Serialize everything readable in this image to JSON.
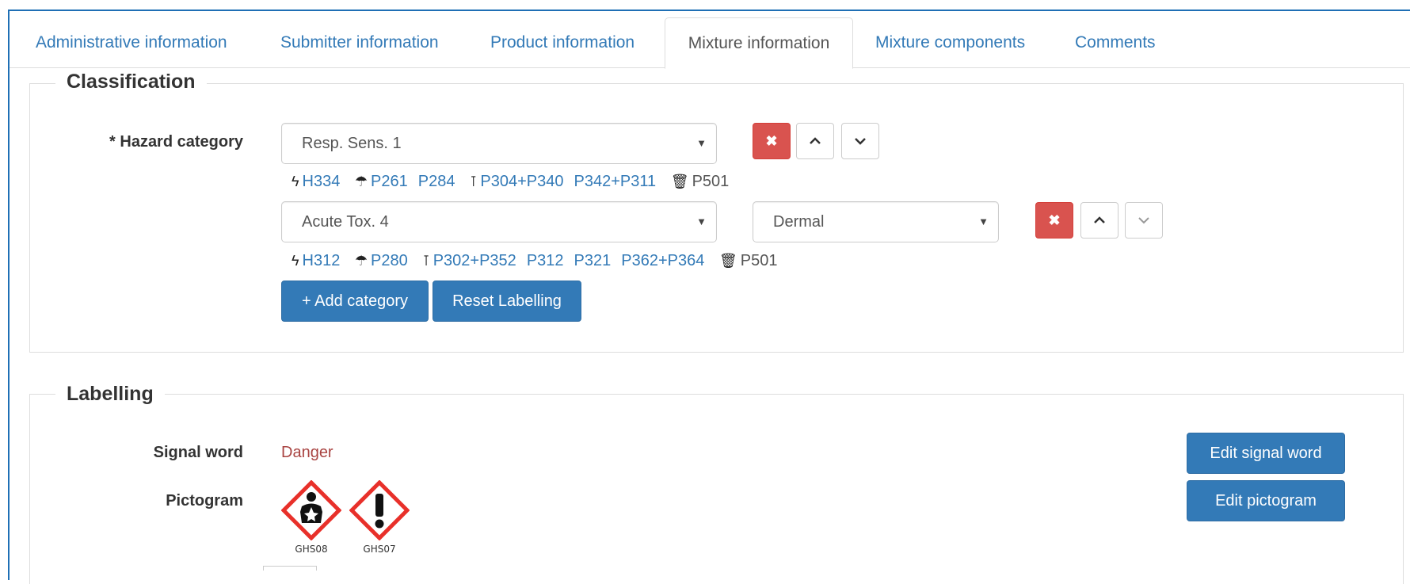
{
  "tabs": [
    {
      "label": "Administrative information",
      "active": false
    },
    {
      "label": "Submitter information",
      "active": false
    },
    {
      "label": "Product information",
      "active": false
    },
    {
      "label": "Mixture information",
      "active": true
    },
    {
      "label": "Mixture components",
      "active": false
    },
    {
      "label": "Comments",
      "active": false
    }
  ],
  "classification": {
    "legend": "Classification",
    "hazard_label": "* Hazard category",
    "rows": [
      {
        "category": "Resp. Sens. 1",
        "route": "",
        "hazard_codes": [
          "H334"
        ],
        "prevention_codes": [
          "P261",
          "P284"
        ],
        "response_codes": [
          "P304+P340",
          "P342+P311"
        ],
        "disposal_codes": [
          "P501"
        ]
      },
      {
        "category": "Acute Tox. 4",
        "route": "Dermal",
        "hazard_codes": [
          "H312"
        ],
        "prevention_codes": [
          "P280"
        ],
        "response_codes": [
          "P302+P352",
          "P312",
          "P321",
          "P362+P364"
        ],
        "disposal_codes": [
          "P501"
        ]
      }
    ],
    "add_category_label": "+ Add category",
    "reset_labelling_label": "Reset Labelling"
  },
  "labelling": {
    "legend": "Labelling",
    "signal_word_label": "Signal word",
    "signal_word_value": "Danger",
    "pictogram_label": "Pictogram",
    "pictograms": [
      {
        "code": "GHS08",
        "icon": "health-hazard-icon"
      },
      {
        "code": "GHS07",
        "icon": "exclamation-mark-icon"
      }
    ],
    "edit_signal_word_label": "Edit signal word",
    "edit_pictogram_label": "Edit pictogram"
  },
  "icons": {
    "hazard": "bolt-icon",
    "prevention": "umbrella-icon",
    "response": "fire-extinguisher-icon",
    "disposal": "trash-icon",
    "remove": "x-icon",
    "move_up": "chevron-up-icon",
    "move_down": "chevron-down-icon",
    "dropdown": "caret-down-icon"
  },
  "colors": {
    "brand_blue": "#337ab7",
    "danger_red": "#d9534f",
    "signal_word": "#a94442",
    "pictogram_border": "#e8302a",
    "frame_border": "#1f6fb5"
  }
}
